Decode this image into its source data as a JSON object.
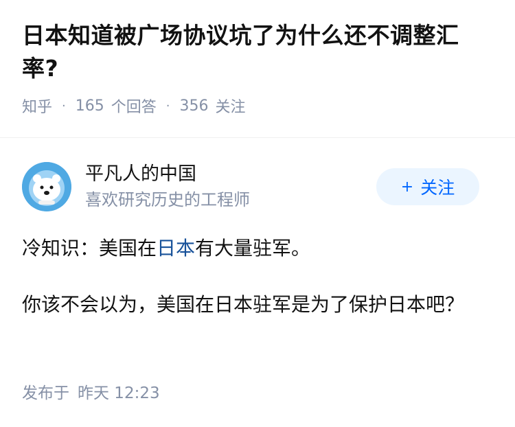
{
  "question": {
    "title": "日本知道被广场协议坑了为什么还不调整汇率?",
    "source": "知乎",
    "answers_count": "165",
    "answers_label": "个回答",
    "followers_count": "356",
    "followers_label": "关注"
  },
  "author": {
    "name": "平凡人的中国",
    "bio": "喜欢研究历史的工程师",
    "follow_label": "关注"
  },
  "answer": {
    "para1_prefix": "冷知识：美国在",
    "para1_link": "日本",
    "para1_suffix": "有大量驻军。",
    "para2": "你该不会以为，美国在日本驻军是为了保护日本吧？"
  },
  "timestamp": {
    "label": "发布于",
    "date": "昨天 12:23"
  },
  "colors": {
    "link": "#175199",
    "follow_text": "#0066ff",
    "follow_bg": "#ebf5ff",
    "meta": "#8590a6"
  }
}
